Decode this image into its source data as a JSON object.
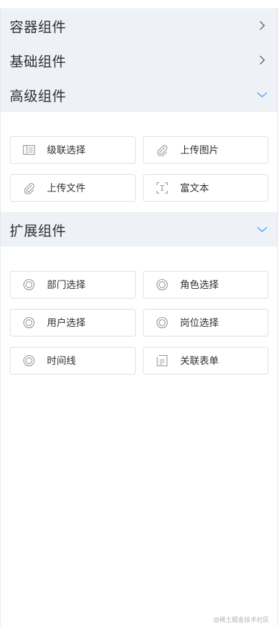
{
  "sections": [
    {
      "title": "容器组件",
      "expanded": false
    },
    {
      "title": "基础组件",
      "expanded": false
    },
    {
      "title": "高级组件",
      "expanded": true,
      "items": [
        {
          "label": "级联选择",
          "icon": "cascader-icon"
        },
        {
          "label": "上传图片",
          "icon": "paperclip-icon"
        },
        {
          "label": "上传文件",
          "icon": "paperclip-icon"
        },
        {
          "label": "富文本",
          "icon": "rich-text-icon"
        }
      ]
    },
    {
      "title": "扩展组件",
      "expanded": true,
      "items": [
        {
          "label": "部门选择",
          "icon": "circle-icon"
        },
        {
          "label": "角色选择",
          "icon": "circle-icon"
        },
        {
          "label": "用户选择",
          "icon": "circle-icon"
        },
        {
          "label": "岗位选择",
          "icon": "circle-icon"
        },
        {
          "label": "时间线",
          "icon": "circle-icon"
        },
        {
          "label": "关联表单",
          "icon": "form-icon"
        }
      ]
    }
  ],
  "watermark": "@稀土掘金技术社区",
  "colors": {
    "header_bg": "#eef1f6",
    "accent": "#409eff",
    "icon_gray": "#909399",
    "border": "#dcdfe6"
  }
}
